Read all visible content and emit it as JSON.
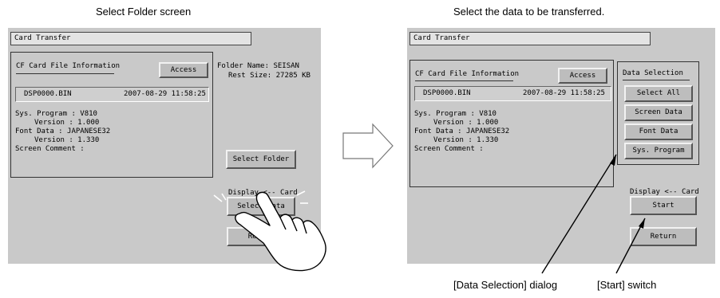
{
  "captions": {
    "left": "Select Folder screen",
    "right": "Select the data to be transferred.",
    "data_selection_dialog": "[Data Selection] dialog",
    "start_switch": "[Start] switch"
  },
  "screen_left": {
    "title": "Card Transfer",
    "section_label": "CF Card File Information",
    "access_button": "Access",
    "file_name": "DSP0000.BIN",
    "file_datetime": "2007-08-29 11:58:25",
    "sys_program_line": "Sys. Program  : V810",
    "sys_version_line": "Version : 1.000",
    "font_data_line": "Font Data     : JAPANESE32",
    "font_version_line": "Version : 1.330",
    "screen_comment_line": "Screen Comment :",
    "folder_name_line": "Folder Name: SEISAN",
    "rest_size_line": "Rest Size:  27285 KB",
    "select_folder_button": "Select Folder",
    "display_card_label": "Display <-- Card",
    "select_data_button": "Select Data",
    "return_button": "Return"
  },
  "screen_right": {
    "title": "Card Transfer",
    "section_label": "CF Card File Information",
    "access_button": "Access",
    "file_name": "DSP0000.BIN",
    "file_datetime": "2007-08-29 11:58:25",
    "sys_program_line": "Sys. Program  : V810",
    "sys_version_line": "Version : 1.000",
    "font_data_line": "Font Data     : JAPANESE32",
    "font_version_line": "Version : 1.330",
    "screen_comment_line": "Screen Comment :",
    "data_selection_label": "Data Selection",
    "select_all_button": "Select All",
    "screen_data_button": "Screen Data",
    "font_data_button": "Font Data",
    "sys_program_button": "Sys. Program",
    "display_card_label": "Display <-- Card",
    "start_button": "Start",
    "return_button": "Return"
  },
  "icons": {
    "transition": "right-arrow-icon",
    "pointer": "hand-pointer-icon"
  },
  "colors": {
    "screen_bg": "#c9c9c9",
    "title_bg": "#e3e3e3",
    "button_bg": "#bdbdbd",
    "page_bg": "#ffffff"
  }
}
